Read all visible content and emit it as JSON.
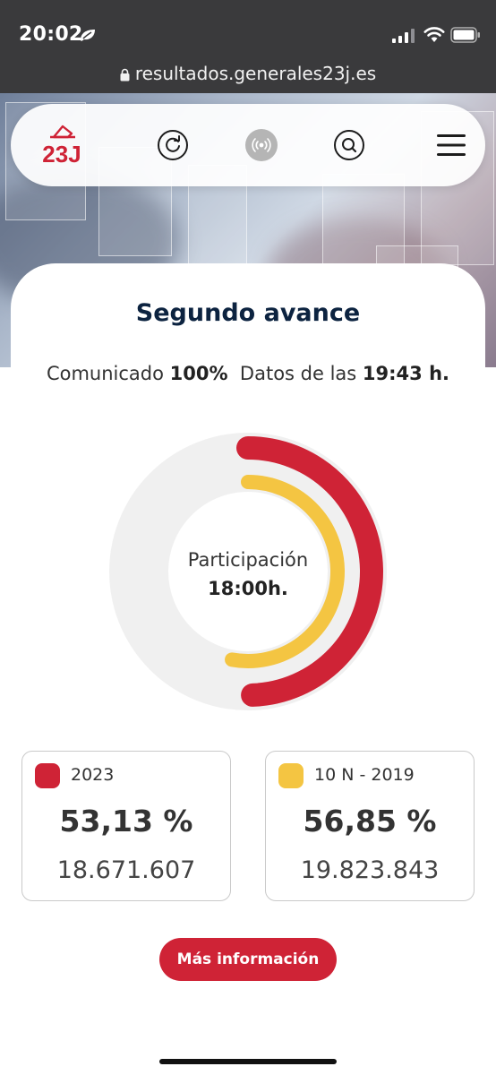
{
  "status_bar": {
    "time": "20:02",
    "url": "resultados.generales23j.es",
    "icons": [
      "leaf-icon",
      "signal-icon",
      "wifi-icon",
      "battery-icon",
      "lock-icon"
    ]
  },
  "nav": {
    "logo_text": "23J",
    "icons": [
      "refresh-icon",
      "live-broadcast-icon",
      "search-icon",
      "menu-icon"
    ]
  },
  "colors": {
    "accent_red": "#cf2336",
    "yellow": "#f4c542",
    "title_navy": "#0c2340",
    "track_gray": "#f0f0f0"
  },
  "main": {
    "title": "Segundo avance",
    "communicated_label": "Comunicado",
    "communicated_value": "100%",
    "data_label": "Datos de las",
    "data_time": "19:43 h."
  },
  "chart": {
    "center_label": "Participación",
    "center_time": "18:00h."
  },
  "chart_data": {
    "type": "radial-bar",
    "series": [
      {
        "name": "2023",
        "value_percent": 53.13,
        "color": "#cf2336"
      },
      {
        "name": "10 N - 2019",
        "value_percent": 56.85,
        "color": "#f4c542"
      }
    ]
  },
  "stats": [
    {
      "label": "2023",
      "percent": "53,13 %",
      "count": "18.671.607",
      "color": "#cf2336"
    },
    {
      "label": "10 N - 2019",
      "percent": "56,85 %",
      "count": "19.823.843",
      "color": "#f4c542"
    }
  ],
  "more_button": {
    "label": "Más información"
  }
}
